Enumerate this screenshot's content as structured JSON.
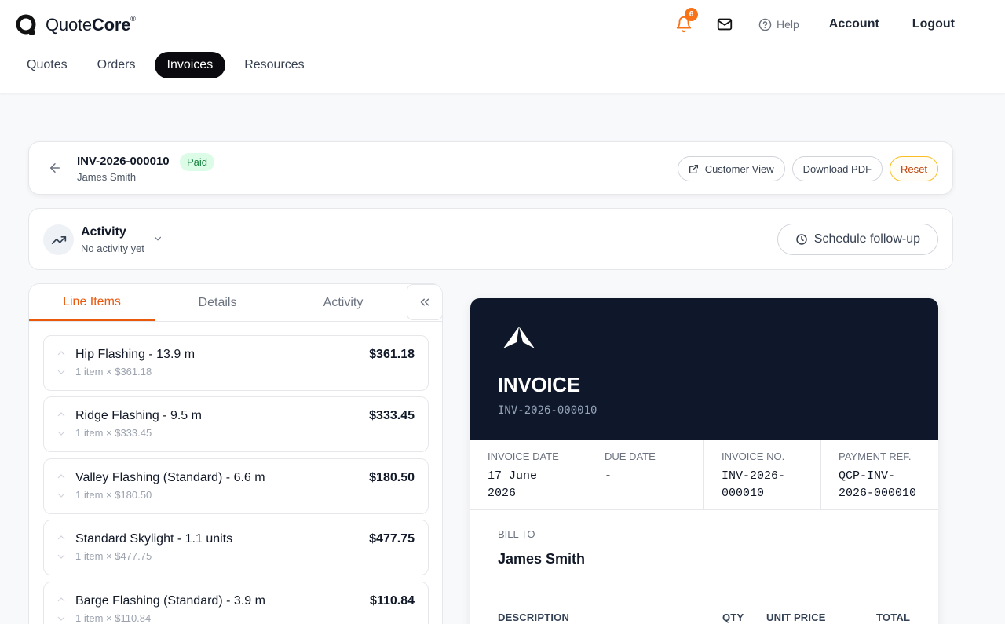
{
  "brand": {
    "name_prefix": "Quote",
    "name_bold": "Core",
    "trademark": "®"
  },
  "nav": {
    "items": [
      {
        "label": "Quotes"
      },
      {
        "label": "Orders"
      },
      {
        "label": "Invoices",
        "active": true
      },
      {
        "label": "Resources"
      }
    ]
  },
  "header": {
    "notification_count": "6",
    "help_label": "Help",
    "account_label": "Account",
    "logout_label": "Logout"
  },
  "invoice_bar": {
    "id": "INV-2026-000010",
    "status": "Paid",
    "customer": "James Smith",
    "customer_view_label": "Customer View",
    "download_label": "Download PDF",
    "reset_label": "Reset"
  },
  "activity_bar": {
    "title": "Activity",
    "subtitle": "No activity yet",
    "schedule_label": "Schedule follow-up"
  },
  "tabs": {
    "line_items": "Line Items",
    "details": "Details",
    "activity": "Activity"
  },
  "line_items": [
    {
      "name": "Hip Flashing",
      "detail": " - 13.9 m",
      "sub": "1 item × $361.18",
      "price": "$361.18"
    },
    {
      "name": "Ridge Flashing",
      "detail": " - 9.5 m",
      "sub": "1 item × $333.45",
      "price": "$333.45"
    },
    {
      "name": "Valley Flashing (Standard)",
      "detail": " - 6.6 m",
      "sub": "1 item × $180.50",
      "price": "$180.50"
    },
    {
      "name": "Standard Skylight",
      "detail": " - 1.1 units",
      "sub": "1 item × $477.75",
      "price": "$477.75"
    },
    {
      "name": "Barge Flashing (Standard)",
      "detail": " - 3.9 m",
      "sub": "1 item × $110.84",
      "price": "$110.84"
    }
  ],
  "preview": {
    "title": "INVOICE",
    "number": "INV-2026-000010",
    "meta": {
      "invoice_date_label": "INVOICE DATE",
      "invoice_date_line1": "17 June",
      "invoice_date_line2": "2026",
      "due_date_label": "DUE DATE",
      "due_date": "-",
      "invoice_no_label": "INVOICE NO.",
      "invoice_no_line1": "INV-2026-",
      "invoice_no_line2": "000010",
      "payment_ref_label": "PAYMENT REF.",
      "payment_ref_line1": "QCP-INV-",
      "payment_ref_line2": "2026-000010"
    },
    "bill_to_label": "BILL TO",
    "bill_to_name": "James Smith",
    "columns": {
      "description": "DESCRIPTION",
      "qty": "QTY",
      "unit_price": "UNIT PRICE",
      "total": "TOTAL"
    }
  },
  "colors": {
    "accent": "#ea580c",
    "badge": "#f97316",
    "paid_bg": "#dcfce7",
    "paid_text": "#15803d",
    "preview_header": "#0f172a"
  }
}
